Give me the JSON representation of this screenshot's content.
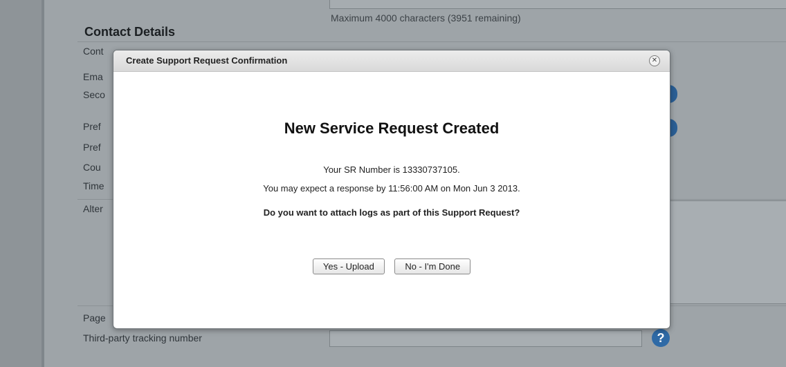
{
  "background": {
    "char_count": "Maximum 4000 characters (3951 remaining)",
    "section_title": "Contact Details",
    "labels": [
      "Cont",
      "Ema",
      "Seco",
      "Pref",
      "Pref",
      "Cou",
      "Time",
      "Alter",
      "Page",
      "Third-party tracking number"
    ]
  },
  "modal": {
    "title": "Create Support Request Confirmation",
    "headline": "New Service Request Created",
    "sr_line": "Your SR Number is 13330737105.",
    "expect_line": "You may expect a response by 11:56:00 AM on Mon Jun 3 2013.",
    "question": "Do you want to attach logs as part of this Support Request?",
    "yes_label": "Yes - Upload",
    "no_label": "No - I'm Done",
    "close_glyph": "✕"
  },
  "icons": {
    "help": "?"
  }
}
